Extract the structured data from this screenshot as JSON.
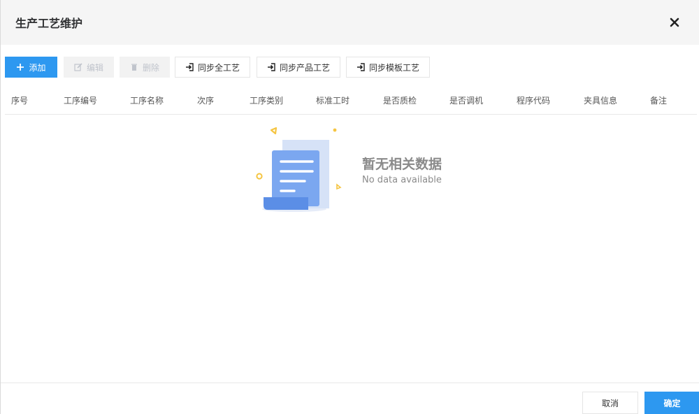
{
  "dialog": {
    "title": "生产工艺维护"
  },
  "toolbar": {
    "add_label": "添加",
    "edit_label": "编辑",
    "delete_label": "删除",
    "sync_all_label": "同步全工艺",
    "sync_product_label": "同步产品工艺",
    "sync_template_label": "同步模板工艺"
  },
  "table": {
    "columns": [
      "序号",
      "工序编号",
      "工序名称",
      "次序",
      "工序类别",
      "标准工时",
      "是否质检",
      "是否调机",
      "程序代码",
      "夹具信息",
      "备注"
    ]
  },
  "empty": {
    "title": "暂无相关数据",
    "subtitle": "No data available"
  },
  "footer": {
    "cancel_label": "取消",
    "confirm_label": "确定"
  },
  "colors": {
    "primary": "#2d98f0",
    "header_bg": "#f5f5f5"
  },
  "icons": {
    "close": "close-icon",
    "add": "plus-icon",
    "edit": "edit-icon",
    "delete": "trash-icon",
    "sync": "import-icon"
  }
}
